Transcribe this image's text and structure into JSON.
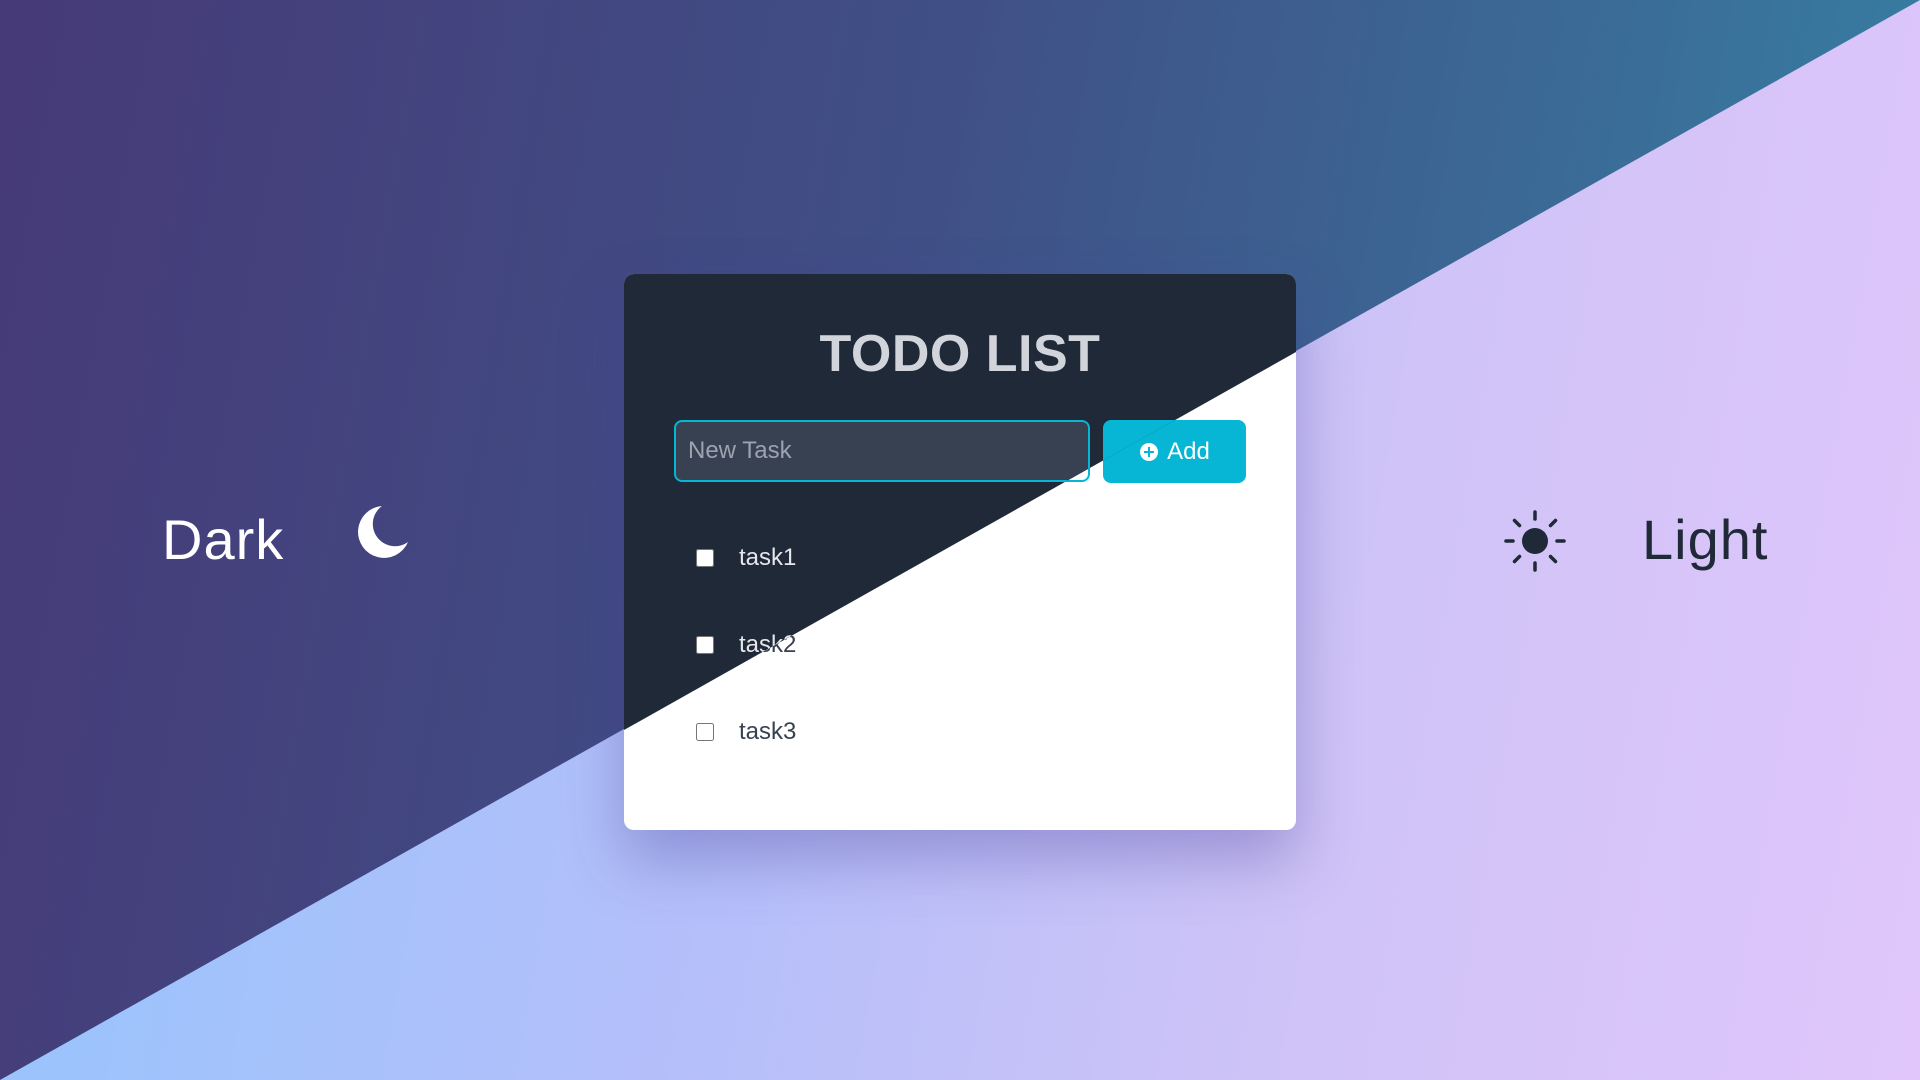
{
  "sides": {
    "dark_label": "Dark",
    "light_label": "Light",
    "dark_icon": "moon-icon",
    "light_icon": "sun-icon"
  },
  "card": {
    "title": "TODO LIST",
    "input": {
      "placeholder": "New Task",
      "value": ""
    },
    "add_button": {
      "label": "Add",
      "icon": "plus-circle-icon"
    },
    "tasks": [
      {
        "label": "task1",
        "checked": false
      },
      {
        "label": "task2",
        "checked": false
      },
      {
        "label": "task3",
        "checked": false
      }
    ]
  },
  "colors": {
    "accent": "#06b6d4",
    "dark_card": "#1f2937",
    "light_card": "#ffffff",
    "dark_text": "#1f2937"
  }
}
